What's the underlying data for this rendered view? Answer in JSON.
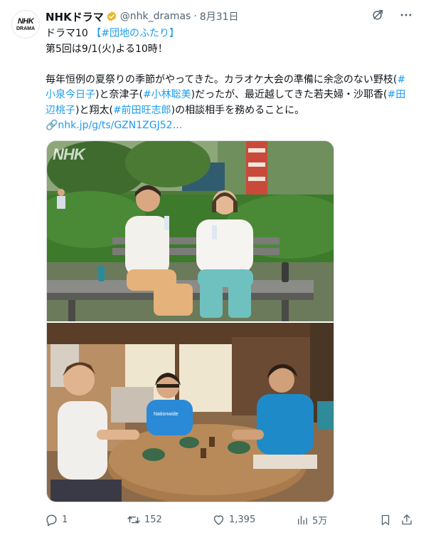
{
  "account": {
    "name": "NHKドラマ",
    "handle": "@nhk_dramas",
    "separator": "·",
    "date": "8月31日",
    "avatar_line1": "NHK",
    "avatar_line2": "DRAMA"
  },
  "tweet": {
    "line1_prefix": "ドラマ10 ",
    "line1_hashtag": "【#団地のふたり】",
    "line2": "第5回は9/1(火)よる10時！",
    "para_a": "毎年恒例の夏祭りの季節がやってきた。カラオケ大会の準備に余念のない野枝(",
    "tag1": "#小泉今日子",
    "para_b": ")と奈津子(",
    "tag2": "#小林聡美",
    "para_c": ")だったが、最近越してきた若夫婦・沙耶香(",
    "tag3": "#田辺桃子",
    "para_d": ")と翔太(",
    "tag4": "#前田旺志郎",
    "para_e": ")の相談相手を務めることに。",
    "link": "🔗nhk.jp/g/ts/GZN1ZGJ52…"
  },
  "media": {
    "watermark": "NHK",
    "photo1_alt": "bench-scene-photo",
    "photo2_alt": "dining-table-scene-photo",
    "shirt_text": "Nationwide"
  },
  "actions": {
    "replies": "1",
    "reposts": "152",
    "likes": "1,395",
    "views": "5万"
  },
  "colors": {
    "accent": "#1d9bf0",
    "muted": "#536471",
    "verified_gold": "#e8b829"
  }
}
